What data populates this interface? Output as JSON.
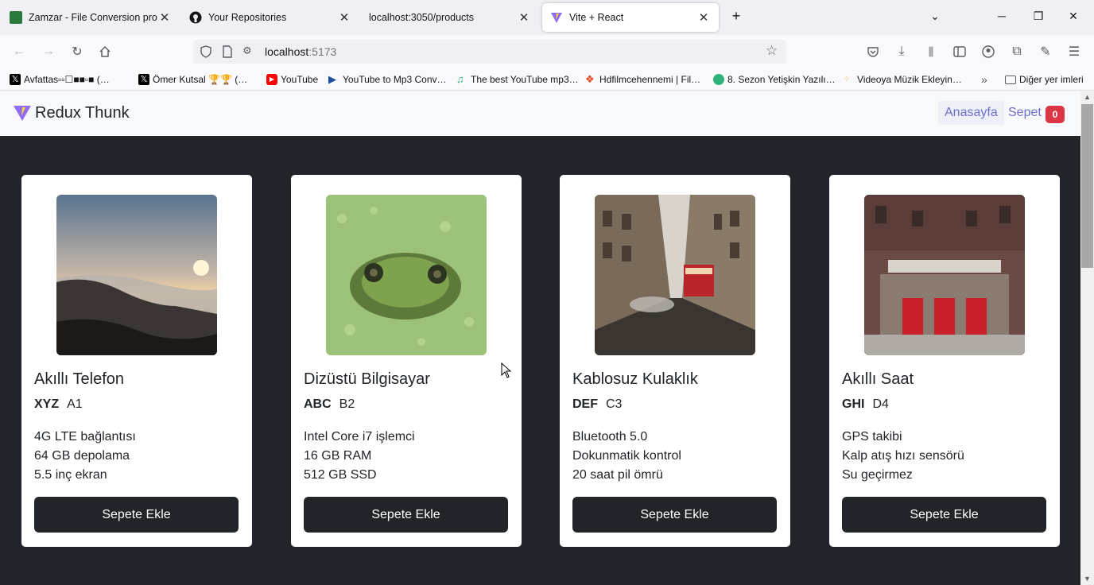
{
  "browser": {
    "tabs": [
      {
        "title": "Zamzar - File Conversion progr",
        "fav_color": "#2b7a3d"
      },
      {
        "title": "Your Repositories",
        "fav_color": "#15141a"
      },
      {
        "title": "localhost:3050/products",
        "fav_color": "#f0f0f4"
      },
      {
        "title": "Vite + React",
        "fav_color": "#8e6cf3"
      }
    ],
    "url_host": "localhost",
    "url_port": ":5173",
    "bookmarks": [
      {
        "label": "Avfattas▫▫☐■■▫■ (…",
        "icon": "x-icon",
        "color": "#000000"
      },
      {
        "label": "Ömer Kutsal 🏆🏆 (…",
        "icon": "x-icon",
        "color": "#000000"
      },
      {
        "label": "YouTube",
        "icon": "youtube-icon",
        "color": "#ff0000"
      },
      {
        "label": "YouTube to Mp3 Conv…",
        "icon": "play-icon",
        "color": "#1b4f9e"
      },
      {
        "label": "The best YouTube mp3…",
        "icon": "music-icon",
        "color": "#2fb37a"
      },
      {
        "label": "Hdfilmcehennemi | Fil…",
        "icon": "film-icon",
        "color": "#e2421a"
      },
      {
        "label": "8. Sezon Yetişkin Yazılı…",
        "icon": "circle-icon",
        "color": "#2fb37a"
      },
      {
        "label": "Videoya Müzik Ekleyin…",
        "icon": "dots-icon",
        "color": "#f5a623"
      }
    ],
    "other_bookmarks": "Diğer yer imleri"
  },
  "app": {
    "brand": "Redux Thunk",
    "nav_home": "Anasayfa",
    "nav_cart": "Sepet",
    "cart_count": "0"
  },
  "products": [
    {
      "name": "Akıllı Telefon",
      "brand": "XYZ",
      "model": "A1",
      "features": [
        "4G LTE bağlantısı",
        "64 GB depolama",
        "5.5 inç ekran"
      ],
      "button": "Sepete Ekle",
      "image": "sunset-mountains"
    },
    {
      "name": "Dizüstü Bilgisayar",
      "brand": "ABC",
      "model": "B2",
      "features": [
        "Intel Core i7 işlemci",
        "16 GB RAM",
        "512 GB SSD"
      ],
      "button": "Sepete Ekle",
      "image": "frog-in-duckweed"
    },
    {
      "name": "Kablosuz Kulaklık",
      "brand": "DEF",
      "model": "C3",
      "features": [
        "Bluetooth 5.0",
        "Dokunmatik kontrol",
        "20 saat pil ömrü"
      ],
      "button": "Sepete Ekle",
      "image": "city-street-bus"
    },
    {
      "name": "Akıllı Saat",
      "brand": "GHI",
      "model": "D4",
      "features": [
        "GPS takibi",
        "Kalp atış hızı sensörü",
        "Su geçirmez"
      ],
      "button": "Sepete Ekle",
      "image": "fire-station-building"
    }
  ]
}
